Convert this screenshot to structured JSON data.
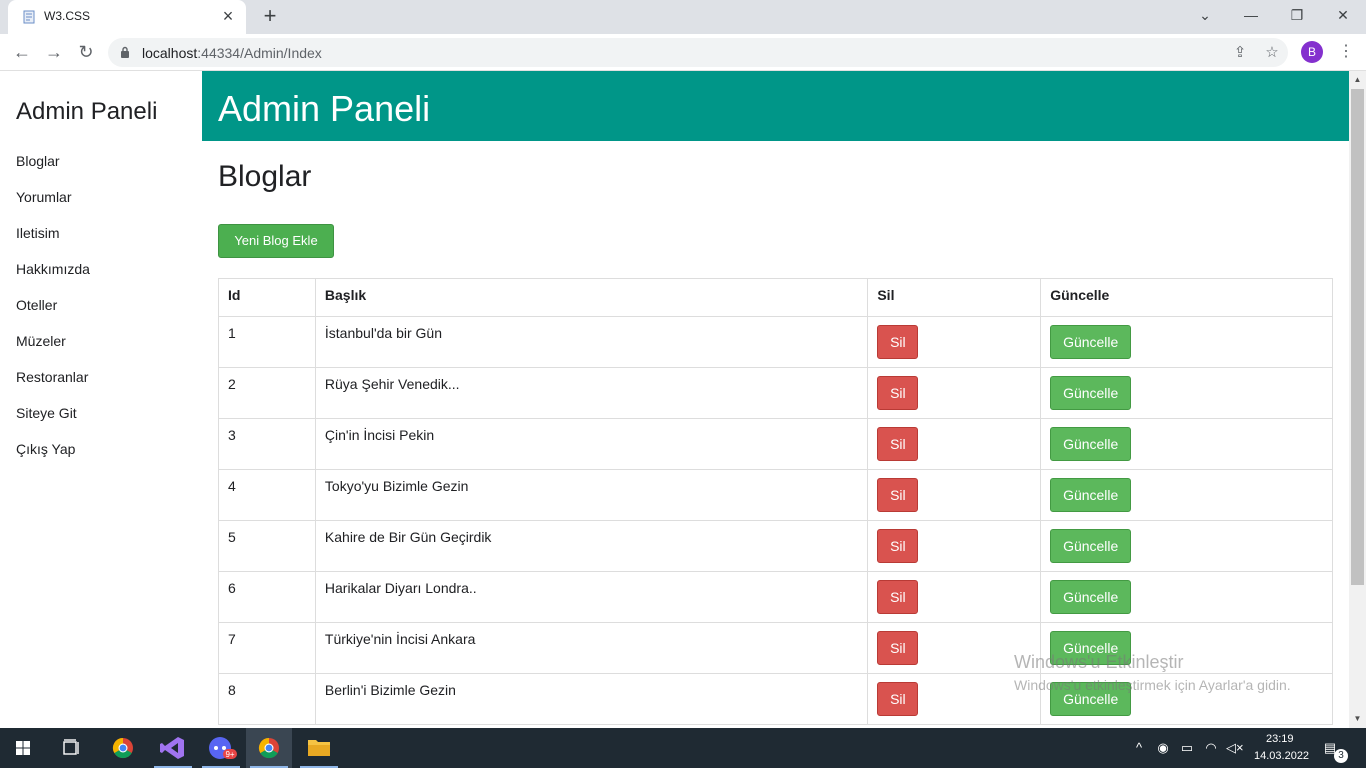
{
  "browser": {
    "tab_title": "W3.CSS",
    "url_host": "localhost",
    "url_rest": ":44334/Admin/Index",
    "profile_initial": "B"
  },
  "sidebar": {
    "title": "Admin Paneli",
    "items": [
      {
        "label": "Bloglar"
      },
      {
        "label": "Yorumlar"
      },
      {
        "label": "Iletisim"
      },
      {
        "label": "Hakkımızda"
      },
      {
        "label": "Oteller"
      },
      {
        "label": "Müzeler"
      },
      {
        "label": "Restoranlar"
      },
      {
        "label": "Siteye Git"
      },
      {
        "label": "Çıkış Yap"
      }
    ]
  },
  "header": {
    "title": "Admin Paneli",
    "color": "#009688"
  },
  "main": {
    "section_title": "Bloglar",
    "add_button": "Yeni Blog Ekle",
    "columns": [
      "Id",
      "Başlık",
      "Sil",
      "Güncelle"
    ],
    "delete_label": "Sil",
    "update_label": "Güncelle",
    "rows": [
      {
        "id": "1",
        "title": "İstanbul'da bir Gün"
      },
      {
        "id": "2",
        "title": "Rüya Şehir Venedik..."
      },
      {
        "id": "3",
        "title": "Çin'in İncisi Pekin"
      },
      {
        "id": "4",
        "title": "Tokyo'yu Bizimle Gezin"
      },
      {
        "id": "5",
        "title": "Kahire de Bir Gün Geçirdik"
      },
      {
        "id": "6",
        "title": "Harikalar Diyarı Londra.."
      },
      {
        "id": "7",
        "title": "Türkiye'nin İncisi Ankara"
      },
      {
        "id": "8",
        "title": "Berlin'i Bizimle Gezin"
      }
    ]
  },
  "watermark": {
    "line1": "Windows'u Etkinleştir",
    "line2": "Windows'u etkinleştirmek için Ayarlar'a gidin."
  },
  "taskbar": {
    "time": "23:19",
    "date": "14.03.2022",
    "notification_count": "3",
    "discord_badge": "9+"
  },
  "colors": {
    "delete": "#d9534f",
    "update": "#5cb85c",
    "add": "#4caf50"
  }
}
